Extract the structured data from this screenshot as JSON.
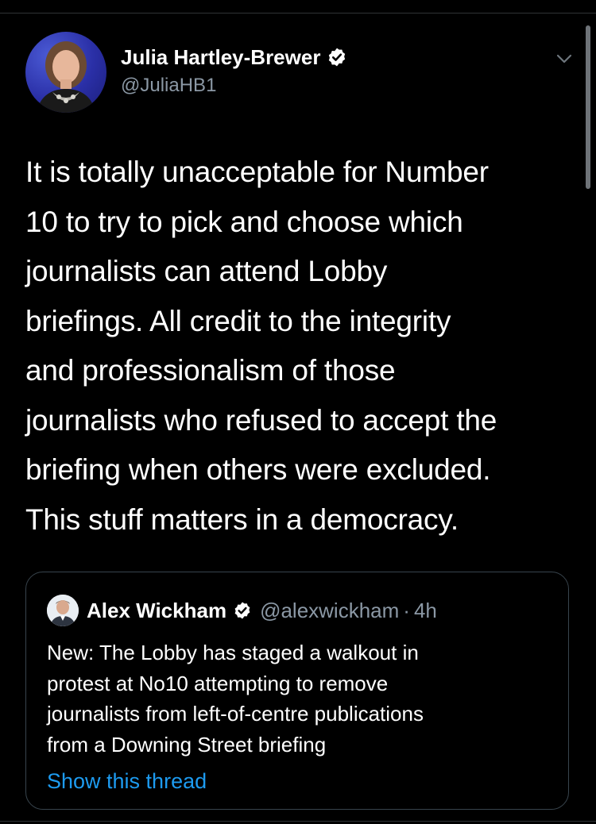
{
  "tweet": {
    "author": {
      "display_name": "Julia Hartley-Brewer",
      "handle": "@JuliaHB1",
      "verified": true,
      "avatar": "avatar-photo"
    },
    "text_lines": [
      "It is totally unacceptable for Number",
      "10 to try to pick and choose which",
      "journalists can attend Lobby",
      "briefings. All credit to the integrity",
      "and professionalism of those",
      "journalists who refused to accept the",
      "briefing when others were excluded.",
      "This stuff matters in a democracy."
    ]
  },
  "quoted_tweet": {
    "author": {
      "display_name": "Alex Wickham",
      "handle": "@alexwickham",
      "separator": "·",
      "time": "4h",
      "verified": true
    },
    "text_lines": [
      "New: The Lobby has staged a walkout in",
      "protest at No10 attempting to remove",
      "journalists from left-of-centre publications",
      "from a Downing Street briefing"
    ],
    "show_thread_label": "Show this thread"
  },
  "colors": {
    "background": "#000000",
    "text_primary": "#ffffff",
    "text_secondary": "#8b98a5",
    "link": "#1d9bf0",
    "border": "#38444d"
  },
  "icons": [
    "verified-badge-icon",
    "chevron-down-icon"
  ]
}
